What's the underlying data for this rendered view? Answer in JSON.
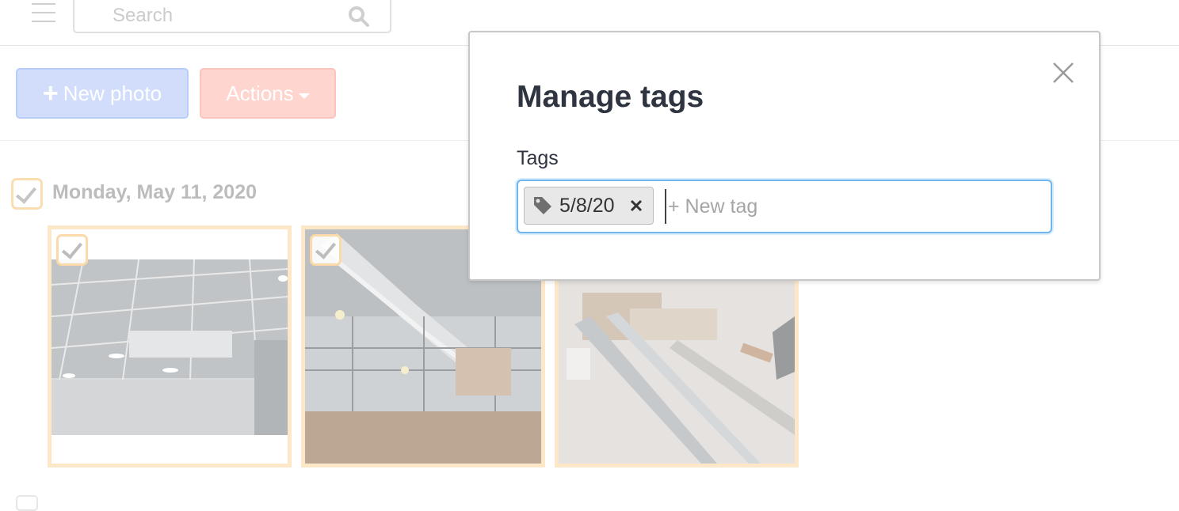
{
  "search": {
    "placeholder": "Search"
  },
  "toolbar": {
    "new_photo_label": "New photo",
    "actions_label": "Actions"
  },
  "group": {
    "date": "Monday, May 11, 2020",
    "checked": true
  },
  "photos": [
    {
      "subject": "ceiling grid with light fixtures",
      "checked": true
    },
    {
      "subject": "exposed ductwork and framing",
      "checked": true
    },
    {
      "subject": "floor with construction materials",
      "checked": true
    }
  ],
  "modal": {
    "title": "Manage tags",
    "tags_label": "Tags",
    "tags": [
      {
        "label": "5/8/20"
      }
    ],
    "new_tag_placeholder": "+ New tag"
  },
  "colors": {
    "primary_button": "#cbd9fb",
    "actions_button": "#ffd0c9",
    "selection_border": "#fde4c2",
    "focus_border": "#6fb5ef",
    "title_text": "#2e3440"
  },
  "icons": {
    "menu": "hamburger-icon",
    "search": "search-icon",
    "close": "close-icon",
    "tag": "tag-icon",
    "remove_tag": "remove-tag-icon"
  }
}
